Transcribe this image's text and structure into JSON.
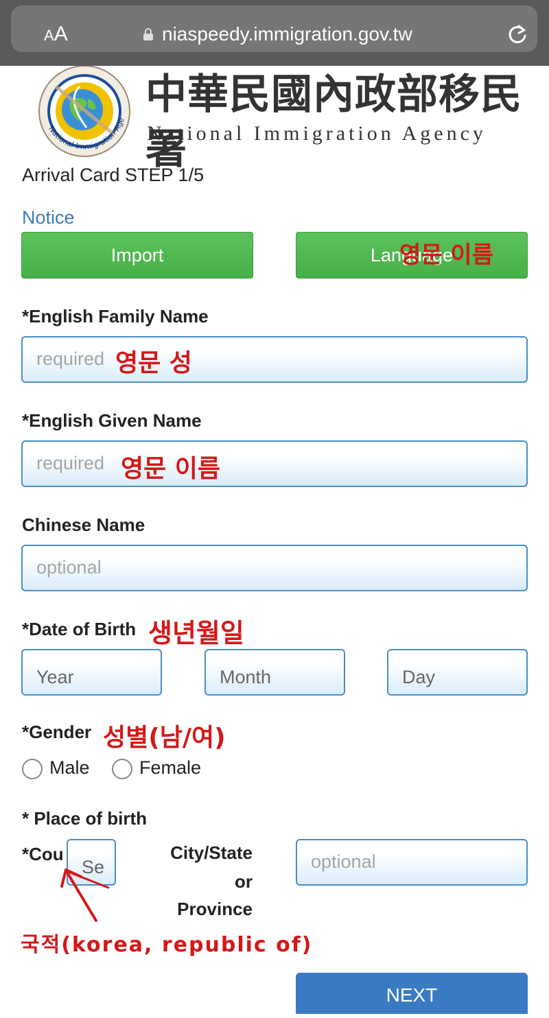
{
  "browser": {
    "text_size_label_small": "A",
    "text_size_label_large": "A",
    "url": "niaspeedy.immigration.gov.tw"
  },
  "header": {
    "agency_cn": "中華民國內政部移民署",
    "agency_en": "National Immigration Agency",
    "seal_text": "National Immigration Agency"
  },
  "form": {
    "step": "Arrival Card STEP 1/5",
    "notice_link": "Notice",
    "import_button": "Import",
    "language_button": "Language",
    "family_name": {
      "label": "*English Family Name",
      "placeholder": "required"
    },
    "given_name": {
      "label": "*English Given Name",
      "placeholder": "required"
    },
    "chinese_name": {
      "label": "Chinese Name",
      "placeholder": "optional"
    },
    "date_of_birth": {
      "label": "*Date of Birth",
      "year": "Year",
      "month": "Month",
      "day": "Day"
    },
    "gender": {
      "label": "*Gender",
      "male": "Male",
      "female": "Female"
    },
    "place_of_birth": {
      "label": "* Place of birth",
      "country_label": "*Cou",
      "country_select": "Se",
      "city_label_1": "City/State",
      "city_label_2": "or",
      "city_label_3": "Province",
      "city_placeholder": "optional"
    },
    "next_button": "NEXT"
  },
  "annotations": {
    "language": "영문 이름",
    "family": "영문 성",
    "given": "영문 이름",
    "birth": "생년월일",
    "gender": "성별(남/여)",
    "nationality": "국적(korea, republic of)"
  },
  "colors": {
    "accent_blue": "#3a7ab8",
    "button_green": "#52b852",
    "annotation_red": "#d41818"
  }
}
